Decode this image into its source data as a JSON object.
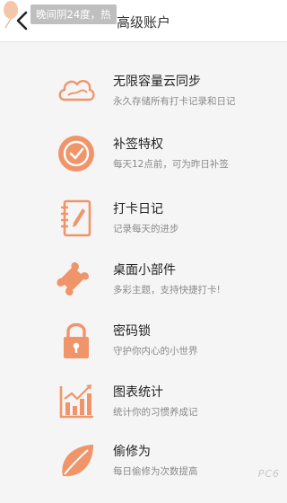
{
  "header": {
    "title": "高级账户"
  },
  "toast": "晚间阴24度，热",
  "colors": {
    "accent": "#f0956a",
    "header_bg": "#ffffff",
    "page_bg": "#f5f5f5"
  },
  "features": [
    {
      "icon": "cloud-icon",
      "name": "无限容量云同步",
      "desc": "永久存储所有打卡记录和日记"
    },
    {
      "icon": "check-icon",
      "name": "补签特权",
      "desc": "每天12点前，可为昨日补签"
    },
    {
      "icon": "diary-icon",
      "name": "打卡日记",
      "desc": "记录每天的进步"
    },
    {
      "icon": "puzzle-icon",
      "name": "桌面小部件",
      "desc": "多彩主题，支持快捷打卡!"
    },
    {
      "icon": "lock-icon",
      "name": "密码锁",
      "desc": "守护你内心的小世界"
    },
    {
      "icon": "chart-icon",
      "name": "图表统计",
      "desc": "统计你的习惯养成记"
    },
    {
      "icon": "leaf-icon",
      "name": "偷修为",
      "desc": "每日偷修为次数提高"
    }
  ],
  "watermark": "PC6"
}
